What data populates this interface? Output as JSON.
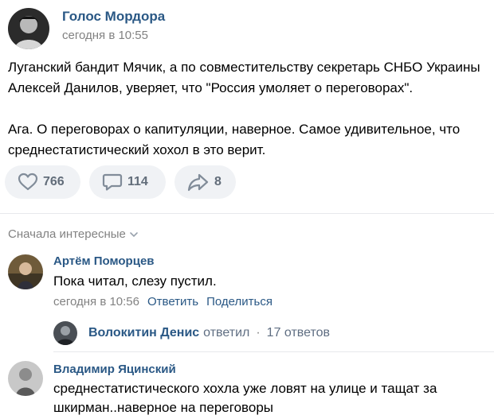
{
  "post": {
    "author": "Голос Мордора",
    "time": "сегодня в 10:55",
    "paragraphs": [
      "Луганский бандит Мячик, а по совместительству секретарь СНБО Украины Алексей Данилов, уверяет, что \"Россия умоляет о переговорах\".",
      "Ага. О переговорах о капитуляции, наверное. Самое удивительное, что среднестатистический хохол в это верит."
    ]
  },
  "actions": {
    "likes": "766",
    "comments": "114",
    "shares": "8",
    "like_icon": "heart-icon",
    "comment_icon": "comment-icon",
    "share_icon": "share-arrow-icon"
  },
  "comments_section": {
    "sort_label": "Сначала интересные",
    "sort_icon": "chevron-down-icon"
  },
  "comments": [
    {
      "author": "Артём Поморцев",
      "text": "Пока читал, слезу пустил.",
      "time": "сегодня в 10:56",
      "reply_label": "Ответить",
      "share_label": "Поделиться",
      "thread": {
        "name": "Волокитин Денис",
        "action": "ответил",
        "separator": "·",
        "count": "17 ответов"
      }
    },
    {
      "author": "Владимир Яцинский",
      "text": "среднестатистического хохла уже ловят на улице и тащат за шкирман..наверное на переговоры"
    }
  ],
  "colors": {
    "link": "#2a5885",
    "muted": "#828282",
    "pill_bg": "#f0f2f5",
    "icon": "#818c99"
  }
}
